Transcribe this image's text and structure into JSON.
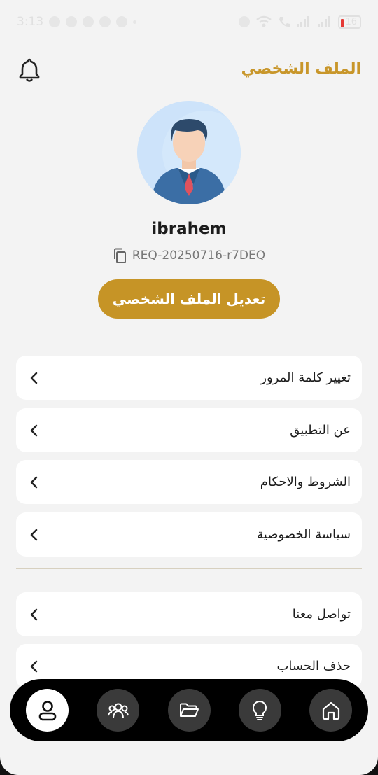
{
  "status_bar": {
    "time": "3:13",
    "battery": "16"
  },
  "header": {
    "title": "الملف الشخصي"
  },
  "profile": {
    "username": "ibrahem",
    "request_id": "REQ-20250716-r7DEQ",
    "edit_button_label": "تعديل الملف الشخصي"
  },
  "menu": {
    "items": [
      {
        "label": "تغيير كلمة المرور"
      },
      {
        "label": "عن التطبيق"
      },
      {
        "label": "الشروط والاحكام"
      },
      {
        "label": "سياسة الخصوصية"
      },
      {
        "label": "تواصل معنا"
      },
      {
        "label": "حذف الحساب"
      }
    ]
  },
  "bottom_nav": {
    "items": [
      "user-icon",
      "group-icon",
      "folder-icon",
      "lightbulb-icon",
      "home-icon"
    ],
    "active": "user-icon"
  },
  "colors": {
    "accent": "#c69426",
    "title": "#c8962a",
    "background": "#f3f3f3",
    "nav": "#000000"
  }
}
